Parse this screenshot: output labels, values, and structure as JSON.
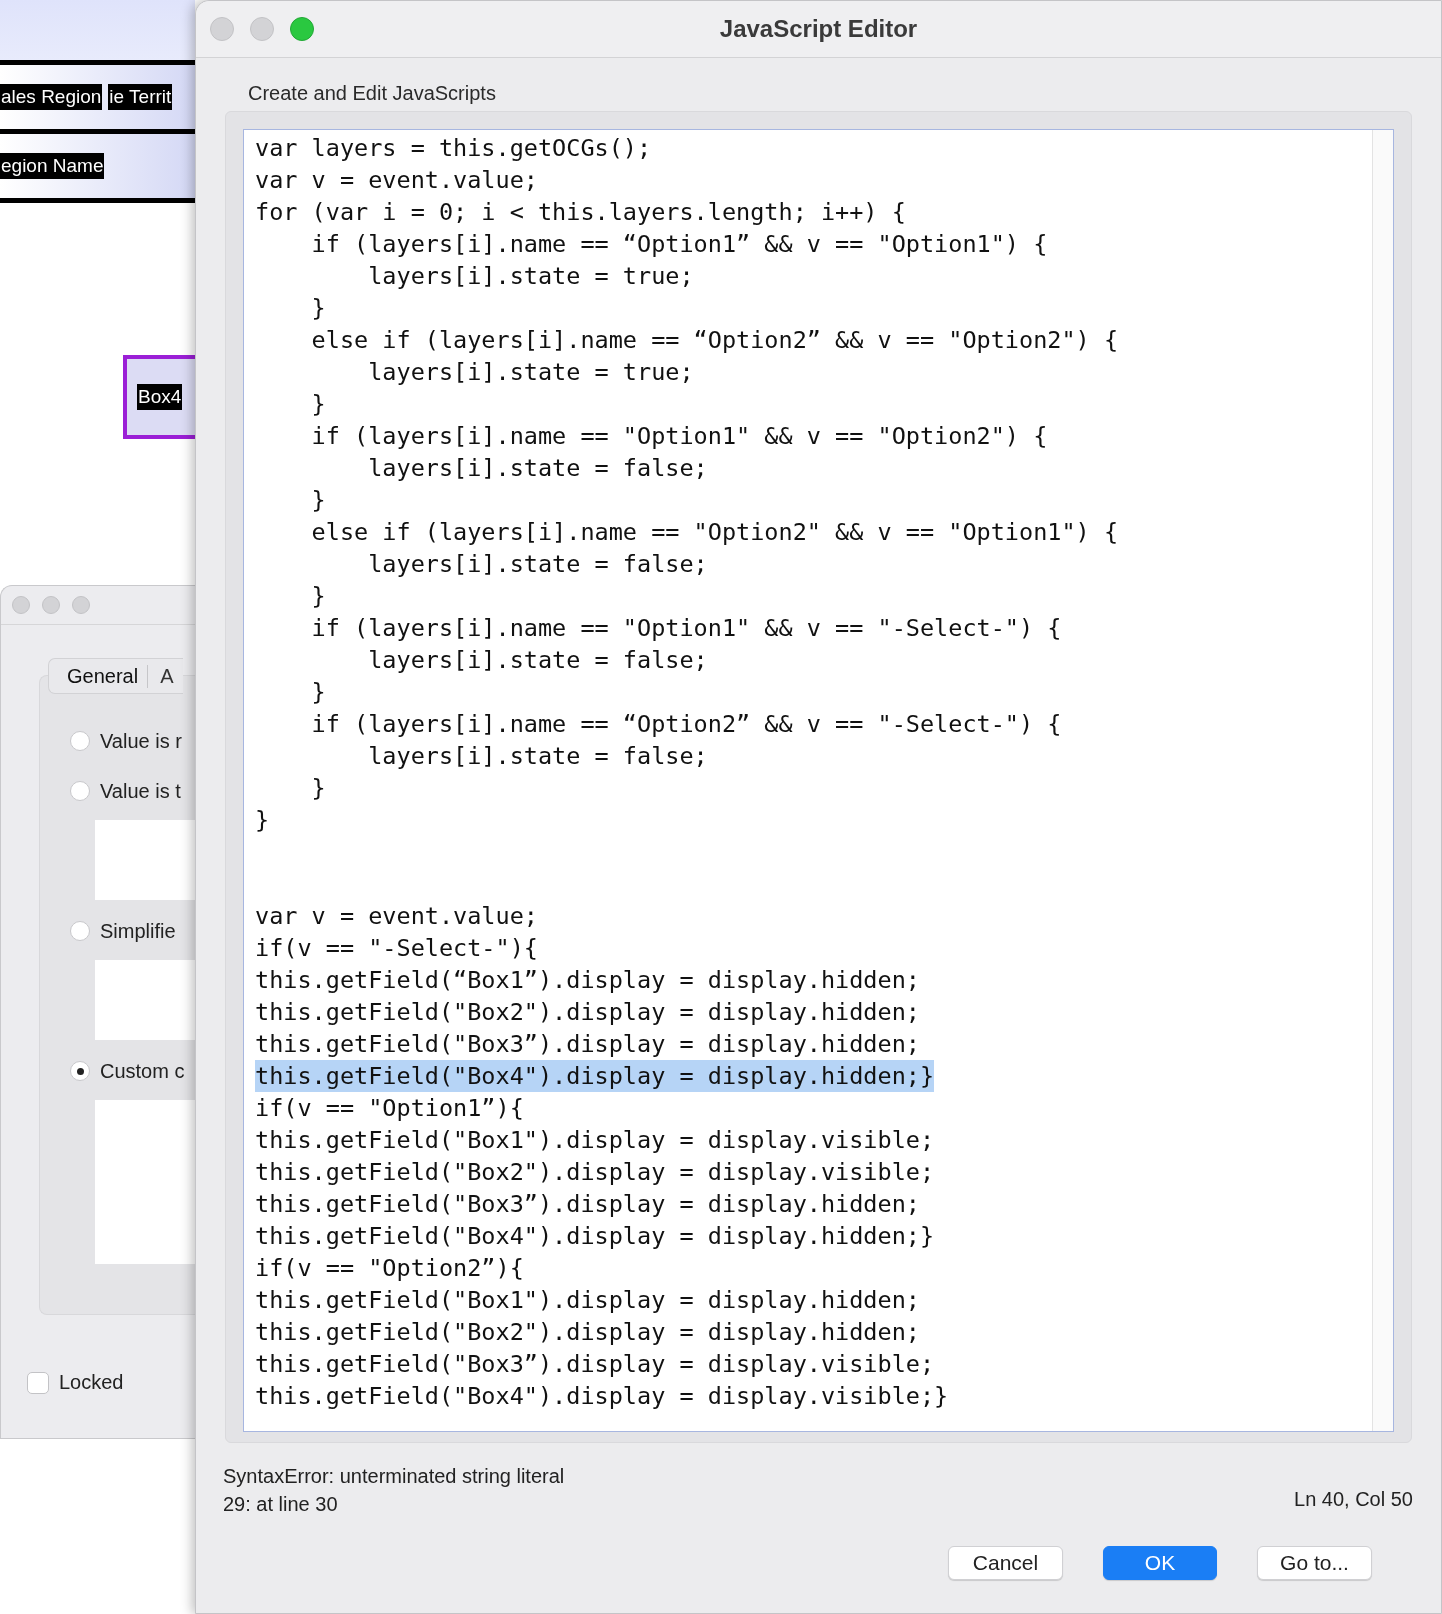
{
  "background": {
    "header_cells": [
      "ales Region",
      "ie Territ"
    ],
    "row_label": "egion Name",
    "field_label": "Box4",
    "dialog": {
      "tabs": [
        {
          "label": "General",
          "selected": true
        },
        {
          "label": "A",
          "selected": false
        }
      ],
      "options": [
        {
          "label": "Value is r",
          "selected": false,
          "text_area": false
        },
        {
          "label": "Value is t",
          "selected": false,
          "text_area": true
        },
        {
          "label": "Simplifie",
          "selected": false,
          "text_area": true
        },
        {
          "label": "Custom c",
          "selected": true,
          "text_area": true
        }
      ],
      "locked": {
        "label": "Locked",
        "checked": false
      }
    }
  },
  "window": {
    "title": "JavaScript Editor"
  },
  "heading": "Create and Edit JavaScripts",
  "code_lines": [
    {
      "kind": "code",
      "text": "var layers = this.getOCGs();",
      "selected": false
    },
    {
      "kind": "code",
      "text": "var v = event.value;",
      "selected": false
    },
    {
      "kind": "code",
      "text": "for (var i = 0; i < this.layers.length; i++) {",
      "selected": false
    },
    {
      "kind": "code",
      "text": "    if (layers[i].name == “Option1” && v == \"Option1\") {",
      "selected": false
    },
    {
      "kind": "code",
      "text": "        layers[i].state = true;",
      "selected": false
    },
    {
      "kind": "code",
      "text": "    }",
      "selected": false
    },
    {
      "kind": "code",
      "text": "    else if (layers[i].name == “Option2” && v == \"Option2\") {",
      "selected": false
    },
    {
      "kind": "code",
      "text": "        layers[i].state = true;",
      "selected": false
    },
    {
      "kind": "code",
      "text": "    }",
      "selected": false
    },
    {
      "kind": "code",
      "text": "    if (layers[i].name == \"Option1\" && v == \"Option2\") {",
      "selected": false
    },
    {
      "kind": "code",
      "text": "        layers[i].state = false;",
      "selected": false
    },
    {
      "kind": "code",
      "text": "    }",
      "selected": false
    },
    {
      "kind": "code",
      "text": "    else if (layers[i].name == \"Option2\" && v == \"Option1\") {",
      "selected": false
    },
    {
      "kind": "code",
      "text": "        layers[i].state = false;",
      "selected": false
    },
    {
      "kind": "code",
      "text": "    }",
      "selected": false
    },
    {
      "kind": "code",
      "text": "    if (layers[i].name == \"Option1\" && v == \"-Select-\") {",
      "selected": false
    },
    {
      "kind": "code",
      "text": "        layers[i].state = false;",
      "selected": false
    },
    {
      "kind": "code",
      "text": "    }",
      "selected": false
    },
    {
      "kind": "code",
      "text": "    if (layers[i].name == “Option2” && v == \"-Select-\") {",
      "selected": false
    },
    {
      "kind": "code",
      "text": "        layers[i].state = false;",
      "selected": false
    },
    {
      "kind": "code",
      "text": "    }",
      "selected": false
    },
    {
      "kind": "code",
      "text": "}",
      "selected": false
    },
    {
      "kind": "blank"
    },
    {
      "kind": "blank"
    },
    {
      "kind": "code",
      "text": "var v = event.value;",
      "selected": false
    },
    {
      "kind": "code",
      "text": "if(v == \"-Select-\"){",
      "selected": false
    },
    {
      "kind": "code",
      "text": "this.getField(“Box1”).display = display.hidden;",
      "selected": false
    },
    {
      "kind": "code",
      "text": "this.getField(\"Box2\").display = display.hidden;",
      "selected": false
    },
    {
      "kind": "code",
      "text": "this.getField(\"Box3”).display = display.hidden;",
      "selected": false
    },
    {
      "kind": "code",
      "text": "this.getField(\"Box4\").display = display.hidden;}",
      "selected": true
    },
    {
      "kind": "code",
      "text": "if(v == \"Option1”){",
      "selected": false
    },
    {
      "kind": "code",
      "text": "this.getField(\"Box1\").display = display.visible;",
      "selected": false
    },
    {
      "kind": "code",
      "text": "this.getField(\"Box2\").display = display.visible;",
      "selected": false
    },
    {
      "kind": "code",
      "text": "this.getField(\"Box3”).display = display.hidden;",
      "selected": false
    },
    {
      "kind": "code",
      "text": "this.getField(\"Box4\").display = display.hidden;}",
      "selected": false
    },
    {
      "kind": "code",
      "text": "if(v == \"Option2”){",
      "selected": false
    },
    {
      "kind": "code",
      "text": "this.getField(\"Box1\").display = display.hidden;",
      "selected": false
    },
    {
      "kind": "code",
      "text": "this.getField(\"Box2\").display = display.hidden;",
      "selected": false
    },
    {
      "kind": "code",
      "text": "this.getField(\"Box3”).display = display.visible;",
      "selected": false
    },
    {
      "kind": "code",
      "text": "this.getField(\"Box4\").display = display.visible;}",
      "selected": false
    }
  ],
  "error": [
    "SyntaxError: unterminated string literal",
    "29: at line 30"
  ],
  "cursor_position": "Ln 40, Col 50",
  "buttons": [
    {
      "label": "Cancel",
      "kind": "default"
    },
    {
      "label": "OK",
      "kind": "primary"
    },
    {
      "label": "Go to...",
      "kind": "default"
    }
  ]
}
